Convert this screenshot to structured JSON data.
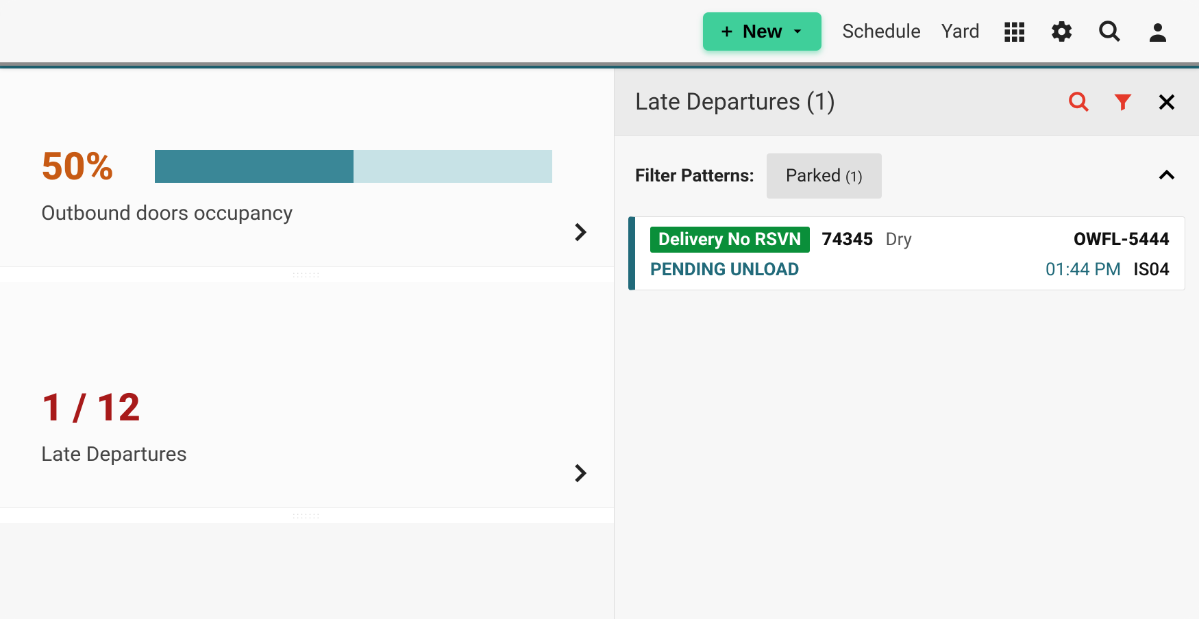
{
  "colors": {
    "accent_teal": "#216a7a",
    "accent_orange": "#c75a14",
    "accent_red": "#a81a1a",
    "green_button": "#3fcf9a",
    "badge_green": "#0a8f3a"
  },
  "header": {
    "new_label": "New",
    "nav_schedule": "Schedule",
    "nav_yard": "Yard"
  },
  "cards": {
    "occupancy": {
      "value": "50%",
      "percent": 50,
      "label": "Outbound doors occupancy"
    },
    "late_departures": {
      "value": "1 / 12",
      "label": "Late Departures"
    }
  },
  "panel": {
    "title": "Late Departures (1)",
    "filter_label": "Filter Patterns:",
    "chip_label": "Parked",
    "chip_count": "(1)",
    "entry": {
      "badge": "Delivery No RSVN",
      "id": "74345",
      "type": "Dry",
      "asset": "OWFL-5444",
      "status": "PENDING UNLOAD",
      "time": "01:44 PM",
      "location": "IS04"
    }
  }
}
